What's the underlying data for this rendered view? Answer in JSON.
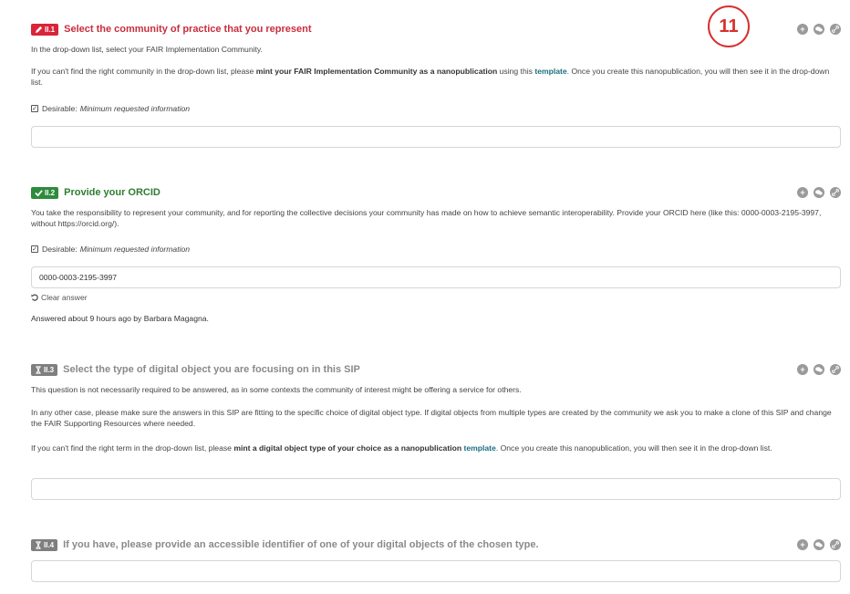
{
  "step_marker": "11",
  "q1": {
    "badge": "II.1",
    "title": "Select the community of practice that you represent",
    "p1": "In the drop-down list, select your FAIR Implementation Community.",
    "p2_a": "If you can't find the right community in the drop-down list, please ",
    "p2_b": "mint your FAIR Implementation Community as a nanopublication",
    "p2_c": " using this ",
    "p2_link": "template",
    "p2_d": ". Once you create this nanopublication, you will then see it in the drop-down list.",
    "desirable_label": "Desirable:",
    "desirable_note": "Minimum requested information",
    "value": ""
  },
  "q2": {
    "badge": "II.2",
    "title": "Provide your ORCID",
    "p1": "You take the responsibility to represent your community, and for reporting the collective decisions your community has made on how to achieve semantic interoperability. Provide your ORCID here (like this: 0000-0003-2195-3997, without https://orcid.org/).",
    "desirable_label": "Desirable:",
    "desirable_note": "Minimum requested information",
    "value": "0000-0003-2195-3997",
    "clear_label": "Clear answer",
    "answered": "Answered about 9 hours ago by Barbara Magagna."
  },
  "q3": {
    "badge": "II.3",
    "title": "Select the type of digital object you are focusing on in this SIP",
    "p1": "This question is not necessarily required to be answered, as in some contexts the community of interest might be offering a service for others.",
    "p2": "In any other case, please make sure the answers in this SIP are fitting to the specific choice of digital object type. If digital objects from multiple types are created by the community we ask you to make a clone of this SIP and change the FAIR Supporting Resources where needed.",
    "p3_a": "If you can't find the right term in the drop-down list, please ",
    "p3_b": "mint a digital object type of your choice as a nanopublication",
    "p3_c": " ",
    "p3_link": "template",
    "p3_d": ". Once you create this nanopublication, you will then see it in the drop-down list.",
    "value": ""
  },
  "q4": {
    "badge": "II.4",
    "title": "If you have, please provide an accessible identifier of one of your digital objects of the chosen type.",
    "value": ""
  },
  "icons": [
    "pencil-icon",
    "check-icon",
    "hourglass-icon",
    "plus-icon",
    "comments-icon",
    "link-icon",
    "undo-icon",
    "checkbox-icon"
  ],
  "colors": {
    "red": "#d9243a",
    "green": "#2e8b3d",
    "gray": "#7f7f7f",
    "link": "#1a6f7e"
  }
}
